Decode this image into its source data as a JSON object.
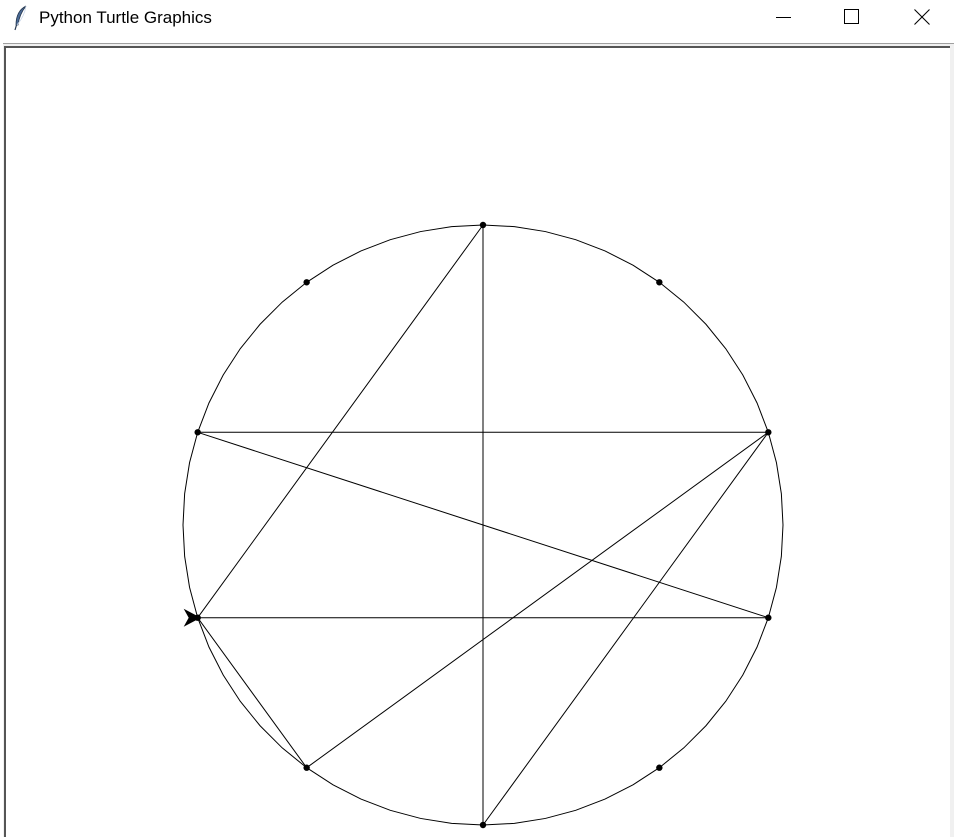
{
  "window": {
    "title": "Python Turtle Graphics",
    "app_icon": "feather-icon",
    "controls": [
      {
        "name": "minimize-button",
        "icon": "minimize-icon"
      },
      {
        "name": "maximize-button",
        "icon": "maximize-icon"
      },
      {
        "name": "close-button",
        "icon": "close-icon"
      }
    ]
  },
  "canvas": {
    "background": "#ffffff",
    "pen_color": "#000000",
    "shape": "arrow-cursor-icon",
    "points_on_circle": 10,
    "chords": [
      [
        7,
        0
      ],
      [
        0,
        5
      ],
      [
        5,
        2
      ],
      [
        2,
        8
      ],
      [
        8,
        3
      ],
      [
        3,
        7
      ],
      [
        7,
        6
      ],
      [
        6,
        2
      ]
    ]
  },
  "colors": {
    "titlebar": "#ffffff",
    "frame": "#f0f0f0",
    "canvas_border": "#555555"
  }
}
